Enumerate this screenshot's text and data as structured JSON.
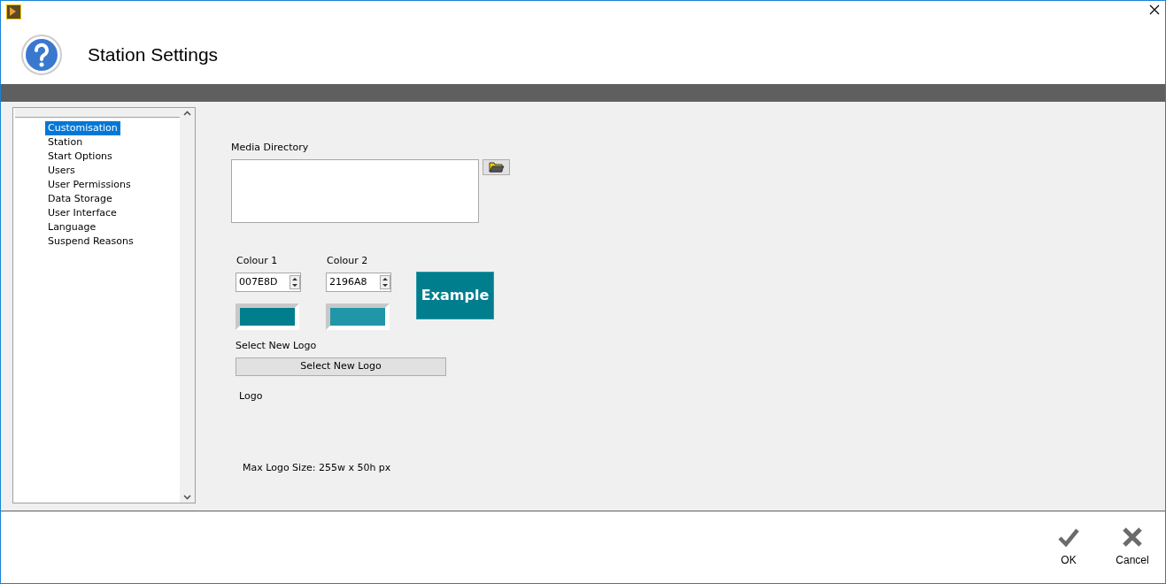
{
  "window": {
    "title": "Station Settings"
  },
  "tree": {
    "items": [
      {
        "label": "Customisation",
        "selected": true
      },
      {
        "label": "Station",
        "selected": false
      },
      {
        "label": "Start Options",
        "selected": false
      },
      {
        "label": "Users",
        "selected": false
      },
      {
        "label": "User Permissions",
        "selected": false
      },
      {
        "label": "Data Storage",
        "selected": false
      },
      {
        "label": "User Interface",
        "selected": false
      },
      {
        "label": "Language",
        "selected": false
      },
      {
        "label": "Suspend Reasons",
        "selected": false
      }
    ]
  },
  "media_directory": {
    "label": "Media Directory"
  },
  "colours": [
    {
      "label": "Colour 1",
      "value": "007E8D",
      "color": "#007e8d"
    },
    {
      "label": "Colour 2",
      "value": "2196A8",
      "color": "#2196a8"
    }
  ],
  "example": {
    "label": "Example",
    "color": "#007e8d"
  },
  "logo": {
    "label": "Select New Logo",
    "button": "Select New Logo",
    "caption": "Logo",
    "note": "Max Logo Size: 255w x 50h px"
  },
  "buttons": [
    {
      "kind": "ok",
      "label": "OK"
    },
    {
      "kind": "cancel",
      "label": "Cancel"
    }
  ]
}
